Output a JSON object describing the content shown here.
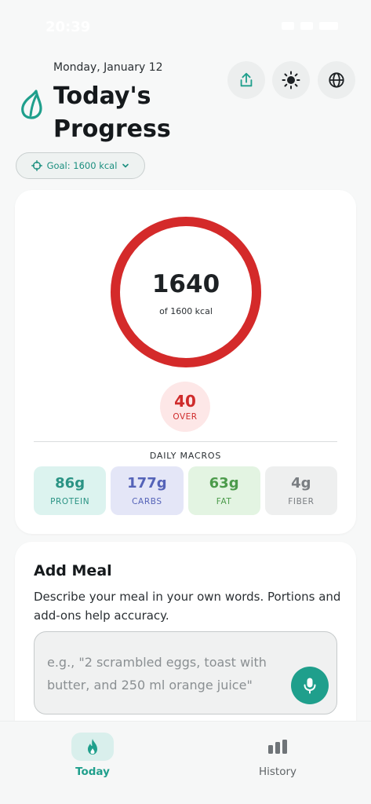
{
  "status": {
    "time": "20:39"
  },
  "header": {
    "date": "Monday, January 12",
    "title": "Today's Progress",
    "buttons": [
      "share-icon",
      "sun-icon",
      "globe-icon"
    ]
  },
  "goal_chip": {
    "label": "Goal: 1600 kcal"
  },
  "progress": {
    "consumed": "1640",
    "subtitle": "of 1600 kcal",
    "ring_fraction": 1.0,
    "over_value": "40",
    "over_label": "OVER"
  },
  "macros": {
    "title": "DAILY MACROS",
    "items": [
      {
        "value": "86g",
        "label": "PROTEIN",
        "bg": "#dcf3ef",
        "color": "#2a9384"
      },
      {
        "value": "177g",
        "label": "CARBS",
        "bg": "#e4e6f7",
        "color": "#5563b8"
      },
      {
        "value": "63g",
        "label": "FAT",
        "bg": "#e3f4e2",
        "color": "#4c9b4b"
      },
      {
        "value": "4g",
        "label": "FIBER",
        "bg": "#eeefef",
        "color": "#7a7e82"
      }
    ]
  },
  "add_meal": {
    "title": "Add Meal",
    "description": "Describe your meal in your own words. Portions and add-ons help accuracy.",
    "placeholder": "e.g., \"2 scrambled eggs, toast with butter, and 250 ml orange juice\""
  },
  "tabs": [
    {
      "label": "Today",
      "active": true
    },
    {
      "label": "History",
      "active": false
    }
  ],
  "colors": {
    "accent": "#1f9f8c",
    "over_red": "#d42a2a"
  }
}
